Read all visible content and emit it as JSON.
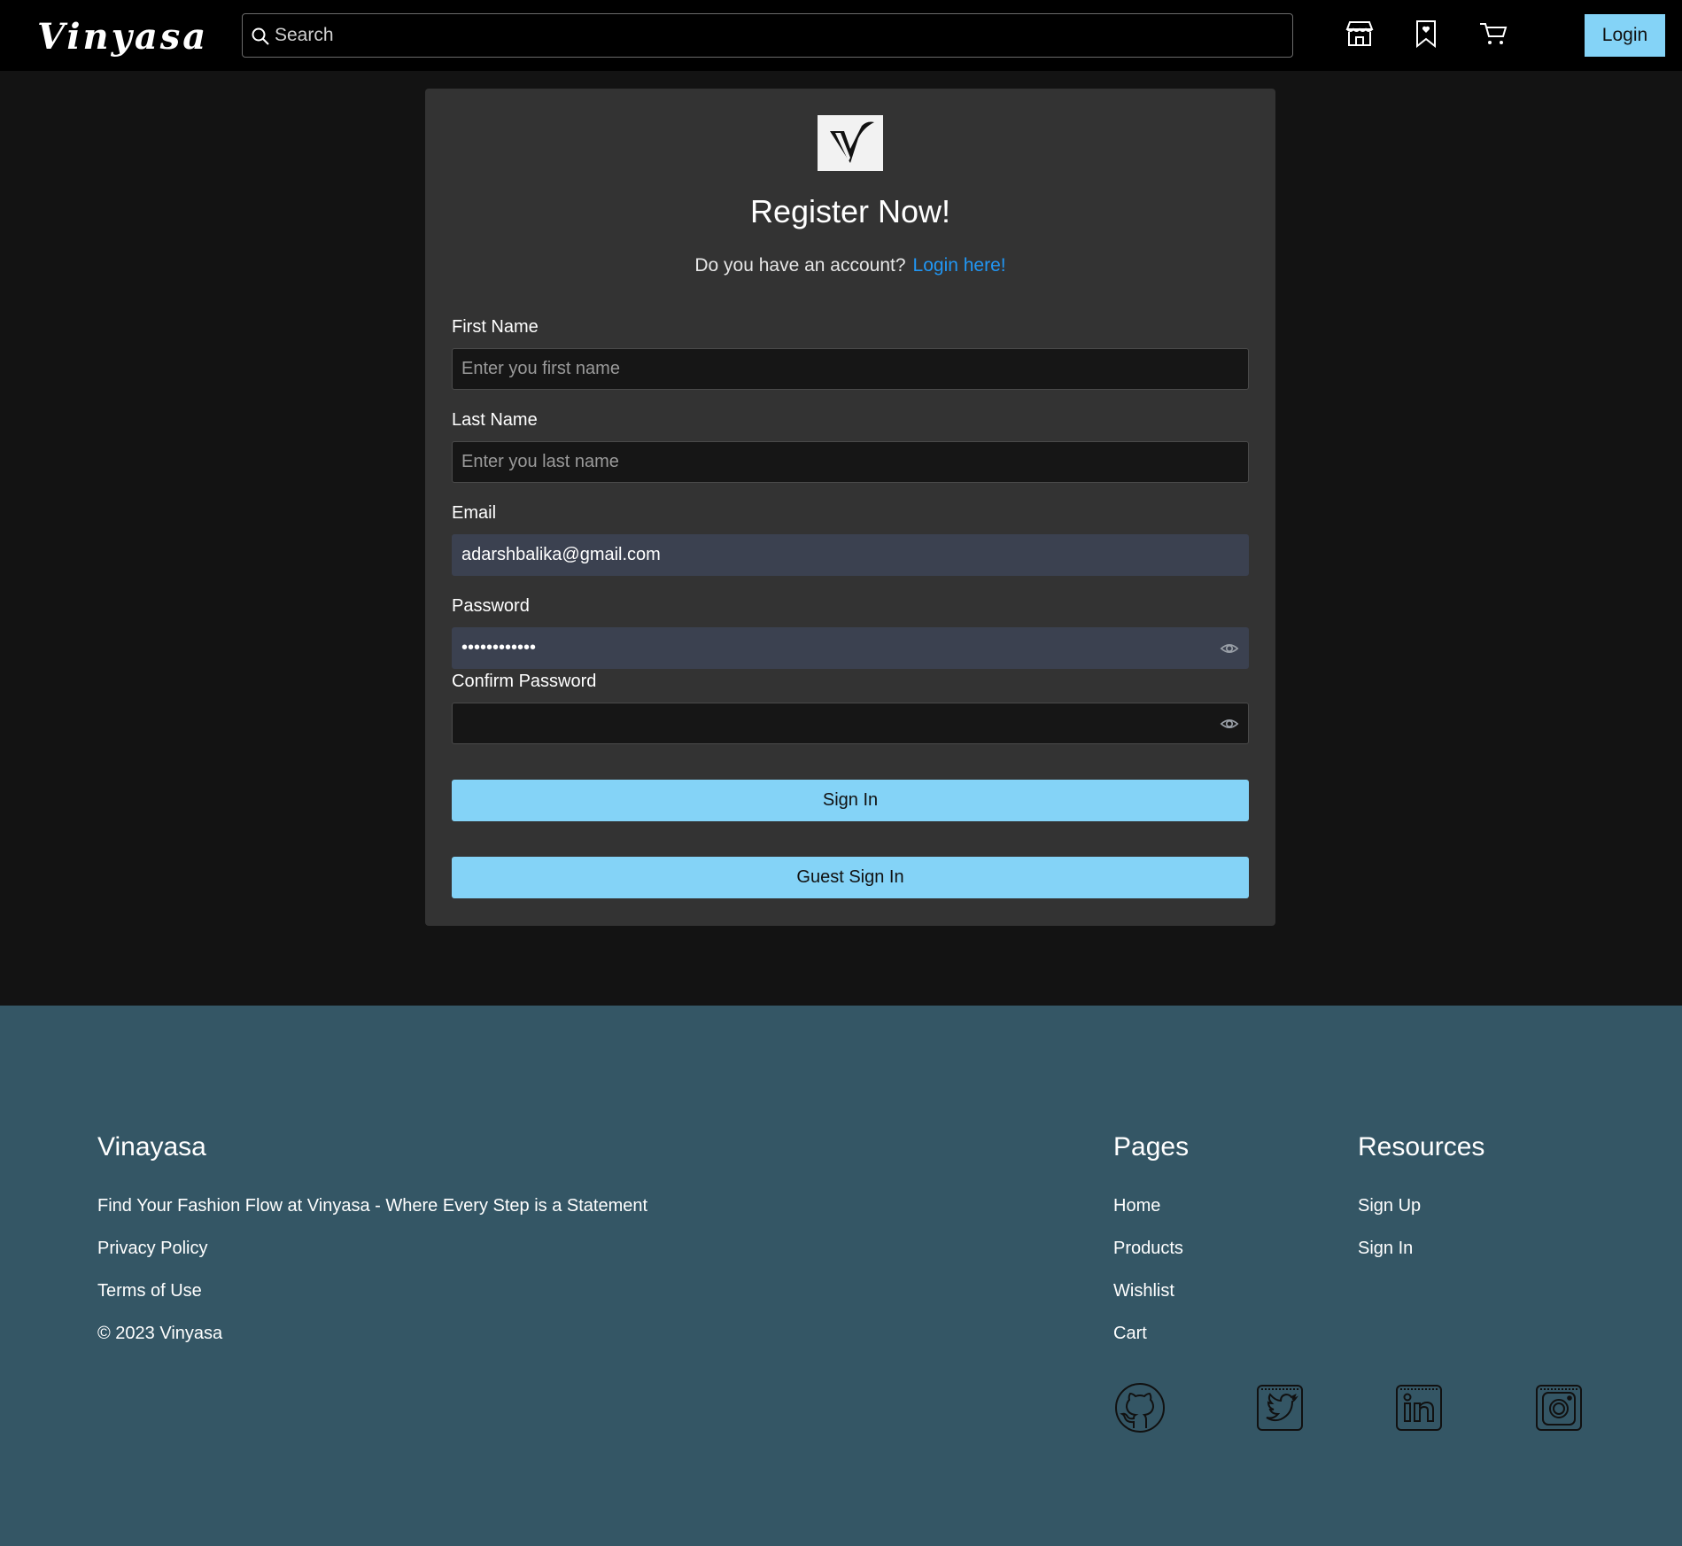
{
  "navbar": {
    "logo": "Vinyasa",
    "search_placeholder": "Search",
    "login_label": "Login"
  },
  "register": {
    "title": "Register Now!",
    "subtitle_text": "Do you have an account?",
    "subtitle_link": "Login here!",
    "first_name": {
      "label": "First Name",
      "placeholder": "Enter you first name",
      "value": ""
    },
    "last_name": {
      "label": "Last Name",
      "placeholder": "Enter you last name",
      "value": ""
    },
    "email": {
      "label": "Email",
      "value": "adarshbalika@gmail.com"
    },
    "password": {
      "label": "Password",
      "value": "••••••••••••"
    },
    "confirm_password": {
      "label": "Confirm Password",
      "value": ""
    },
    "sign_in_label": "Sign In",
    "guest_sign_in_label": "Guest Sign In"
  },
  "footer": {
    "brand": "Vinayasa",
    "tagline": "Find Your Fashion Flow at Vinyasa - Where Every Step is a Statement",
    "privacy": "Privacy Policy",
    "terms": "Terms of Use",
    "copyright": "© 2023 Vinyasa",
    "pages_heading": "Pages",
    "pages": [
      "Home",
      "Products",
      "Wishlist",
      "Cart"
    ],
    "resources_heading": "Resources",
    "resources": [
      "Sign Up",
      "Sign In"
    ],
    "social_icons": [
      "github-icon",
      "twitter-icon",
      "linkedin-icon",
      "instagram-icon"
    ]
  },
  "colors": {
    "accent": "#84d3f7",
    "link": "#2196f3",
    "footer_bg": "#345665",
    "card_bg": "#333333",
    "page_bg": "#131313"
  }
}
